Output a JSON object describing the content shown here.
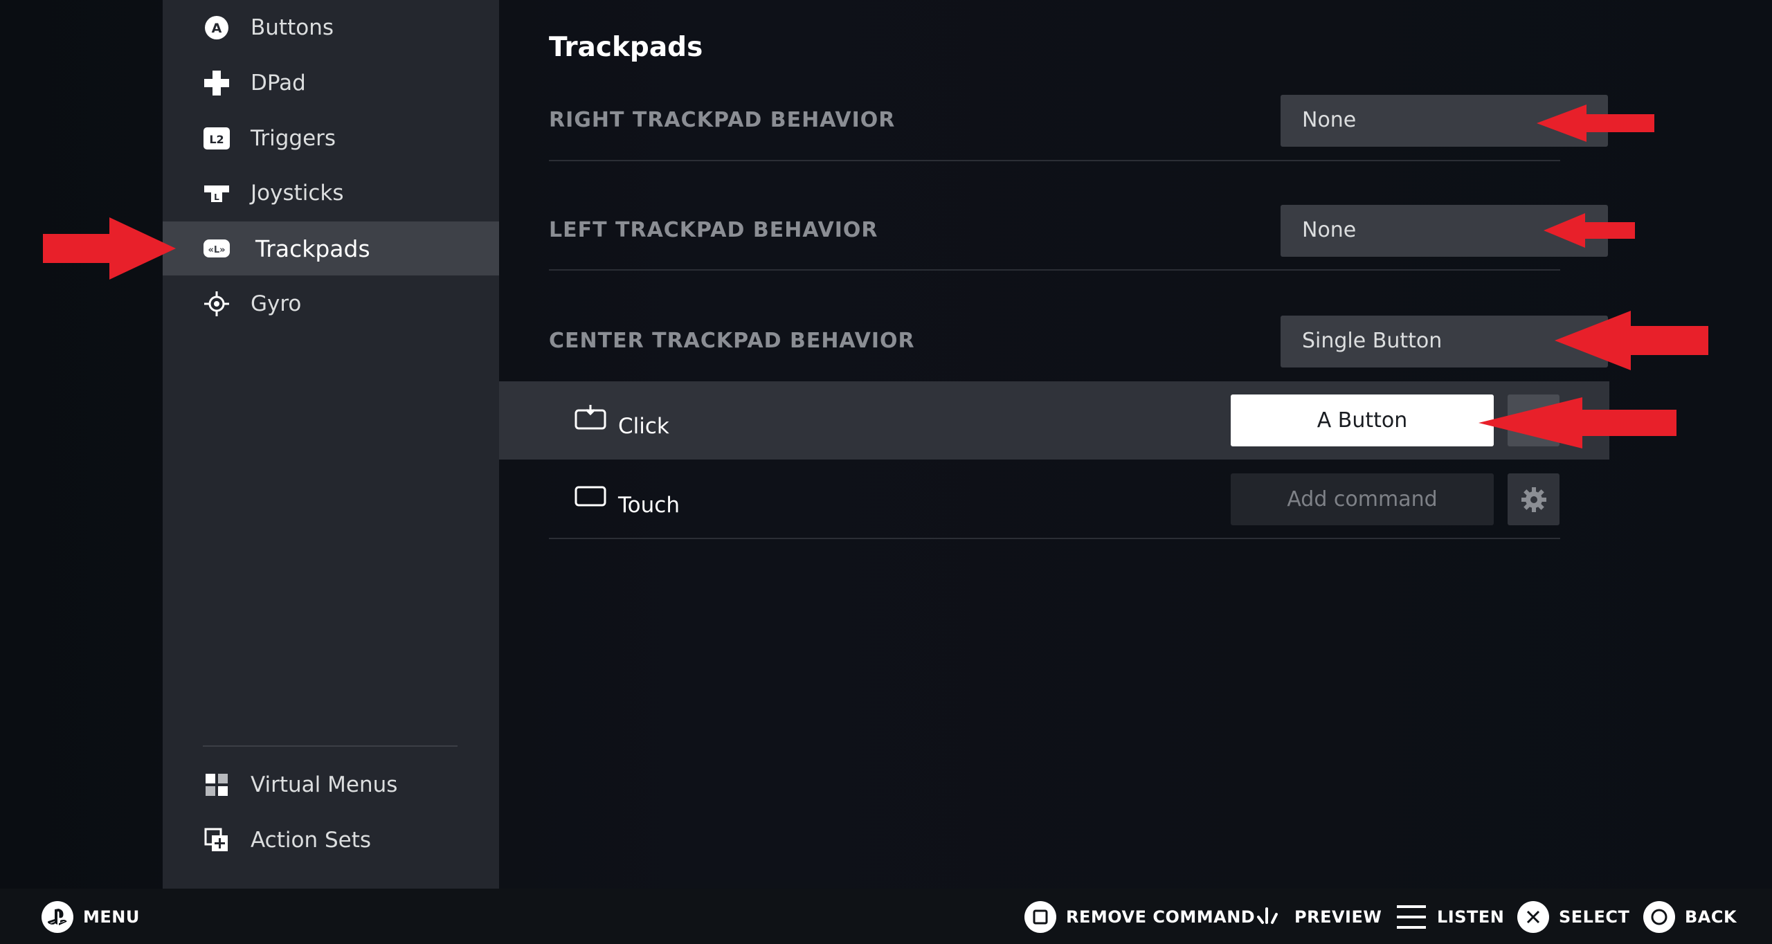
{
  "sidebar": {
    "items": [
      {
        "label": "Buttons",
        "icon": "a-button-icon"
      },
      {
        "label": "DPad",
        "icon": "dpad-icon"
      },
      {
        "label": "Triggers",
        "icon": "l2-trigger-icon"
      },
      {
        "label": "Joysticks",
        "icon": "joystick-icon"
      },
      {
        "label": "Trackpads",
        "icon": "trackpad-icon",
        "active": true
      },
      {
        "label": "Gyro",
        "icon": "gyro-icon"
      }
    ],
    "bottom_items": [
      {
        "label": "Virtual Menus",
        "icon": "grid-icon"
      },
      {
        "label": "Action Sets",
        "icon": "action-sets-icon"
      }
    ]
  },
  "main": {
    "title": "Trackpads",
    "settings": [
      {
        "label": "RIGHT TRACKPAD BEHAVIOR",
        "value": "None"
      },
      {
        "label": "LEFT TRACKPAD BEHAVIOR",
        "value": "None"
      },
      {
        "label": "CENTER TRACKPAD BEHAVIOR",
        "value": "Single Button"
      }
    ],
    "bindings": [
      {
        "label": "Click",
        "command": "A Button",
        "icon": "trackpad-click-icon"
      },
      {
        "label": "Touch",
        "command": "Add command",
        "icon": "trackpad-touch-icon"
      }
    ]
  },
  "footer": {
    "menu": "MENU",
    "remove_command": "REMOVE COMMAND",
    "preview": "PREVIEW",
    "listen": "LISTEN",
    "select": "SELECT",
    "back": "BACK"
  },
  "colors": {
    "sidebar_bg": "#24272e",
    "active_item_bg": "#3e4148",
    "dropdown_bg": "#3a3d44",
    "annotation_arrow": "#e8202a"
  }
}
